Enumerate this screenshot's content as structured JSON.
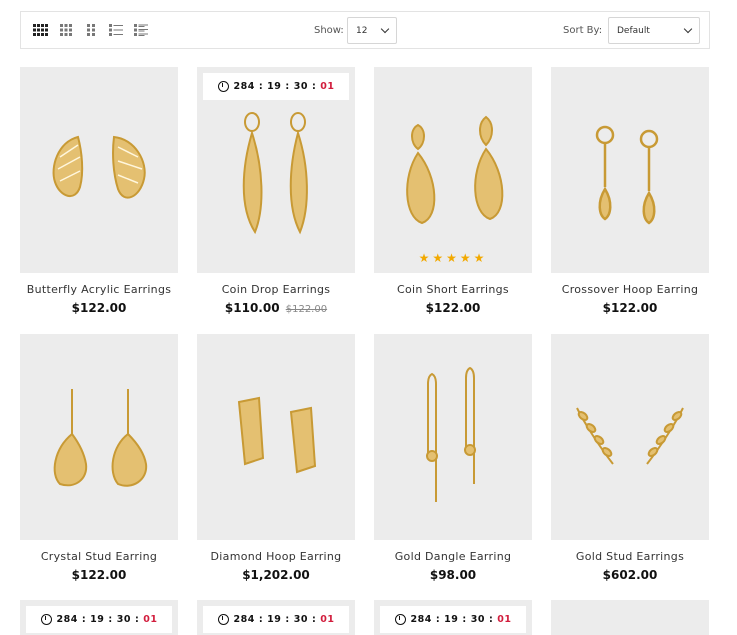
{
  "toolbar": {
    "show_label": "Show:",
    "show_value": "12",
    "sort_label": "Sort By:",
    "sort_value": "Default",
    "view_icons": [
      "grid-4-icon",
      "grid-3-icon",
      "grid-2-icon",
      "list-icon",
      "list-detail-icon"
    ]
  },
  "timer": {
    "days": "284",
    "hours": "19",
    "minutes": "30",
    "seconds": "01"
  },
  "products": [
    {
      "name": "Butterfly Acrylic Earrings",
      "price": "$122.00",
      "old_price": ""
    },
    {
      "name": "Coin Drop Earrings",
      "price": "$110.00",
      "old_price": "$122.00"
    },
    {
      "name": "Coin Short Earrings",
      "price": "$122.00",
      "old_price": "",
      "rating": 5
    },
    {
      "name": "Crossover Hoop Earring",
      "price": "$122.00",
      "old_price": ""
    },
    {
      "name": "Crystal Stud Earring",
      "price": "$122.00",
      "old_price": ""
    },
    {
      "name": "Diamond Hoop Earring",
      "price": "$1,202.00",
      "old_price": ""
    },
    {
      "name": "Gold Dangle Earring",
      "price": "$98.00",
      "old_price": ""
    },
    {
      "name": "Gold Stud Earrings",
      "price": "$602.00",
      "old_price": ""
    }
  ],
  "colors": {
    "accent_red": "#d21d3d",
    "star": "#f2a900",
    "gold": "#d9a93c",
    "image_bg": "#ececec"
  }
}
